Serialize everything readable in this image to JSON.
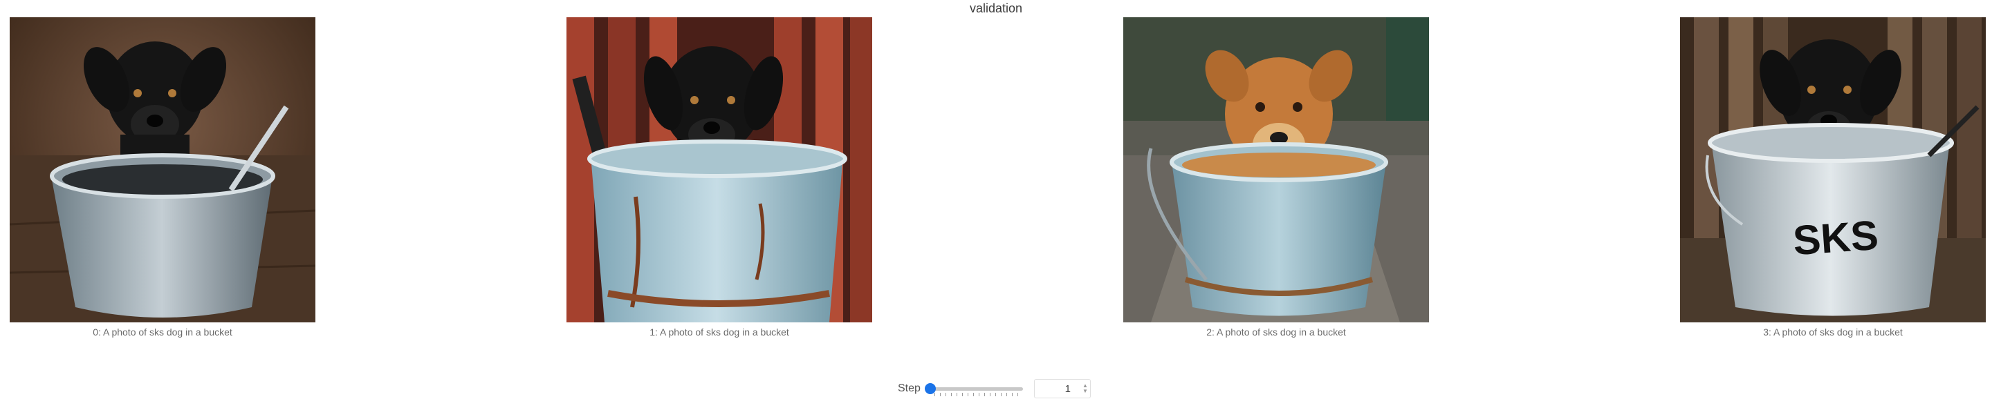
{
  "panel": {
    "title": "validation"
  },
  "media": [
    {
      "caption": "0: A photo of sks dog in a bucket",
      "dog_color": "black",
      "bucket_text": ""
    },
    {
      "caption": "1: A photo of sks dog in a bucket",
      "dog_color": "black",
      "bucket_text": ""
    },
    {
      "caption": "2: A photo of sks dog in a bucket",
      "dog_color": "golden",
      "bucket_text": ""
    },
    {
      "caption": "3: A photo of sks dog in a bucket",
      "dog_color": "black",
      "bucket_text": "SKS"
    }
  ],
  "step_control": {
    "label": "Step",
    "value": "1",
    "slider_fraction": 0.0
  },
  "colors": {
    "accent": "#1a73e8"
  }
}
